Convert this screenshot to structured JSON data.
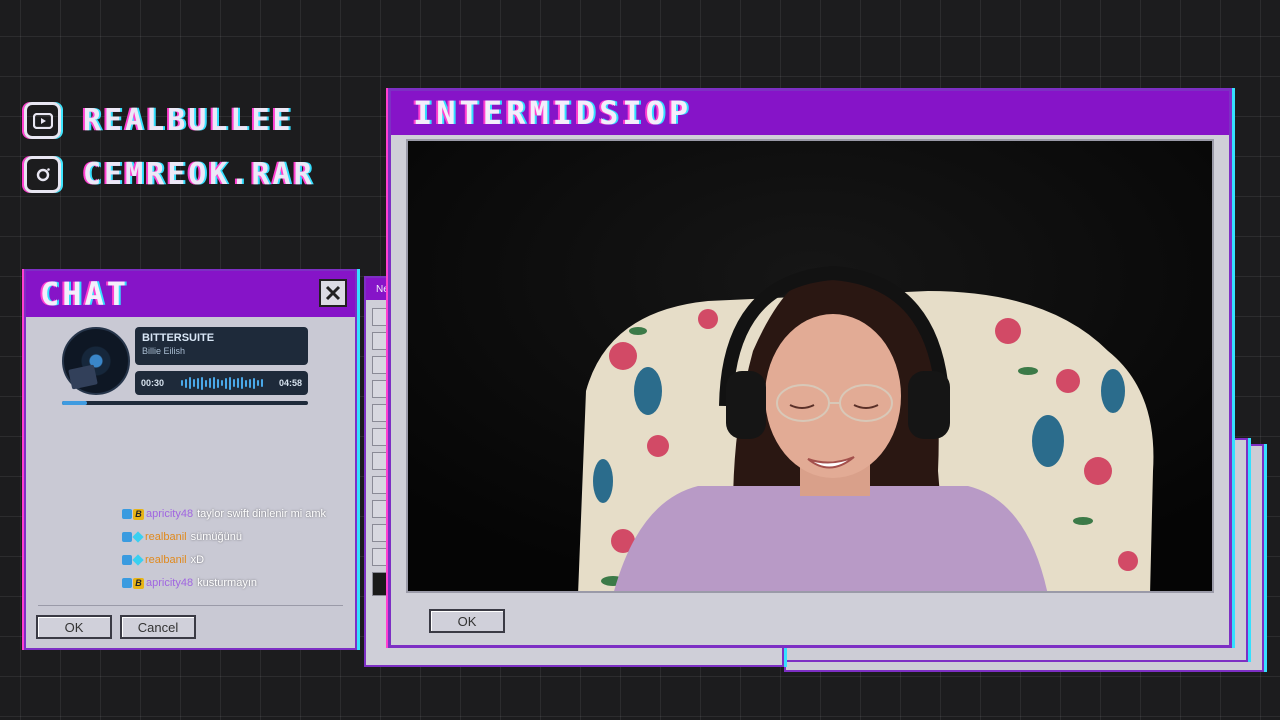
{
  "socials": [
    {
      "icon": "youtube-icon",
      "handle": "REALBULLEE"
    },
    {
      "icon": "instagram-icon",
      "handle": "CEMREOK.RAR"
    }
  ],
  "chat_window": {
    "title": "CHAT",
    "now_playing": {
      "title": "BITTERSUITE",
      "artist": "Billie Eilish",
      "elapsed": "00:30",
      "duration": "04:58",
      "progress": 0.1
    },
    "messages": [
      {
        "user": "apricity48",
        "badge": "B",
        "text": "taylor swift dinlenir mi amk"
      },
      {
        "user": "realbanil",
        "badge": "cube",
        "text": "sümüğünü"
      },
      {
        "user": "realbanil",
        "badge": "cube",
        "text": "xD"
      },
      {
        "user": "apricity48",
        "badge": "B",
        "text": "kusturmayın"
      }
    ],
    "ok_label": "OK",
    "cancel_label": "Cancel"
  },
  "paint_window": {
    "title": "Ne"
  },
  "main_window": {
    "title": "INTERMIDSIOP",
    "ok_label": "OK"
  },
  "colors": {
    "accent_purple": "#8614c8",
    "glitch_pink": "#ff3fd0",
    "glitch_cyan": "#35e0ff",
    "window_gray": "#cfcfd8"
  }
}
